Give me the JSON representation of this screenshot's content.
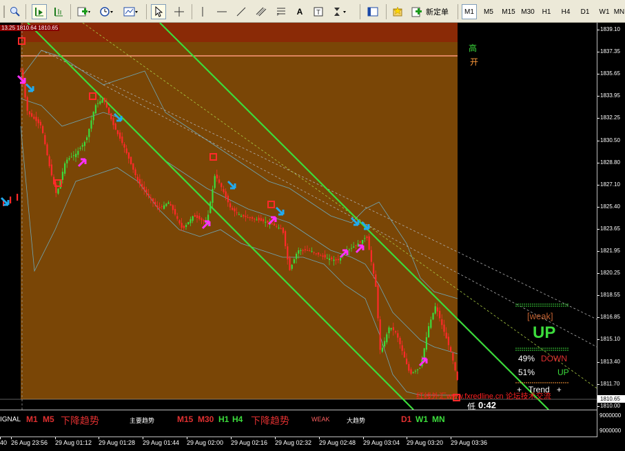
{
  "toolbar": {
    "new_order_label": "新定单",
    "timeframes": [
      "M1",
      "M5",
      "M15",
      "M30",
      "H1",
      "H4",
      "D1",
      "W1",
      "MN"
    ],
    "active_timeframe": "M1"
  },
  "chart": {
    "ohlc_text": "13.25  1810.64  1810.65",
    "high_label": "高",
    "open_label": "开",
    "low_label": "低",
    "countdown": "0:42",
    "current_price": "1810.65",
    "price_ticks": [
      "1839.10",
      "1837.35",
      "1835.65",
      "1833.95",
      "1832.25",
      "1830.50",
      "1828.80",
      "1827.10",
      "1825.40",
      "1823.65",
      "1821.95",
      "1820.25",
      "1818.55",
      "1816.85",
      "1815.10",
      "1813.40",
      "1811.70",
      "1810.00"
    ],
    "weak_label": "[weak]",
    "signal_label": "UP",
    "down_percent": "49%",
    "down_label": "DOWN",
    "up_percent": "51%",
    "up_label": "UP",
    "trend_label": "+   Trend   +",
    "watermark": "www.fxredline.cn 论坛技术交流",
    "watermark_prefix": "红线外汇"
  },
  "indicator": {
    "signal_prefix": "IGNAL",
    "m1": "M1",
    "m5": "M5",
    "short_trend": "下降趋势",
    "main_trend_label": "主要趋势",
    "m15": "M15",
    "m30": "M30",
    "h1": "H1",
    "h4": "H4",
    "mid_trend": "下降趋势",
    "weak": "WEAK",
    "big_trend_label": "大趋势",
    "d1": "D1",
    "w1": "W1",
    "mn": "MN",
    "axis_top": "9000000",
    "axis_bottom": "9000000"
  },
  "time_axis": [
    "40",
    "26 Aug 23:56",
    "29 Aug 01:12",
    "29 Aug 01:28",
    "29 Aug 01:44",
    "29 Aug 02:00",
    "29 Aug 02:16",
    "29 Aug 02:32",
    "29 Aug 02:48",
    "29 Aug 03:04",
    "29 Aug 03:20",
    "29 Aug 03:36"
  ]
}
